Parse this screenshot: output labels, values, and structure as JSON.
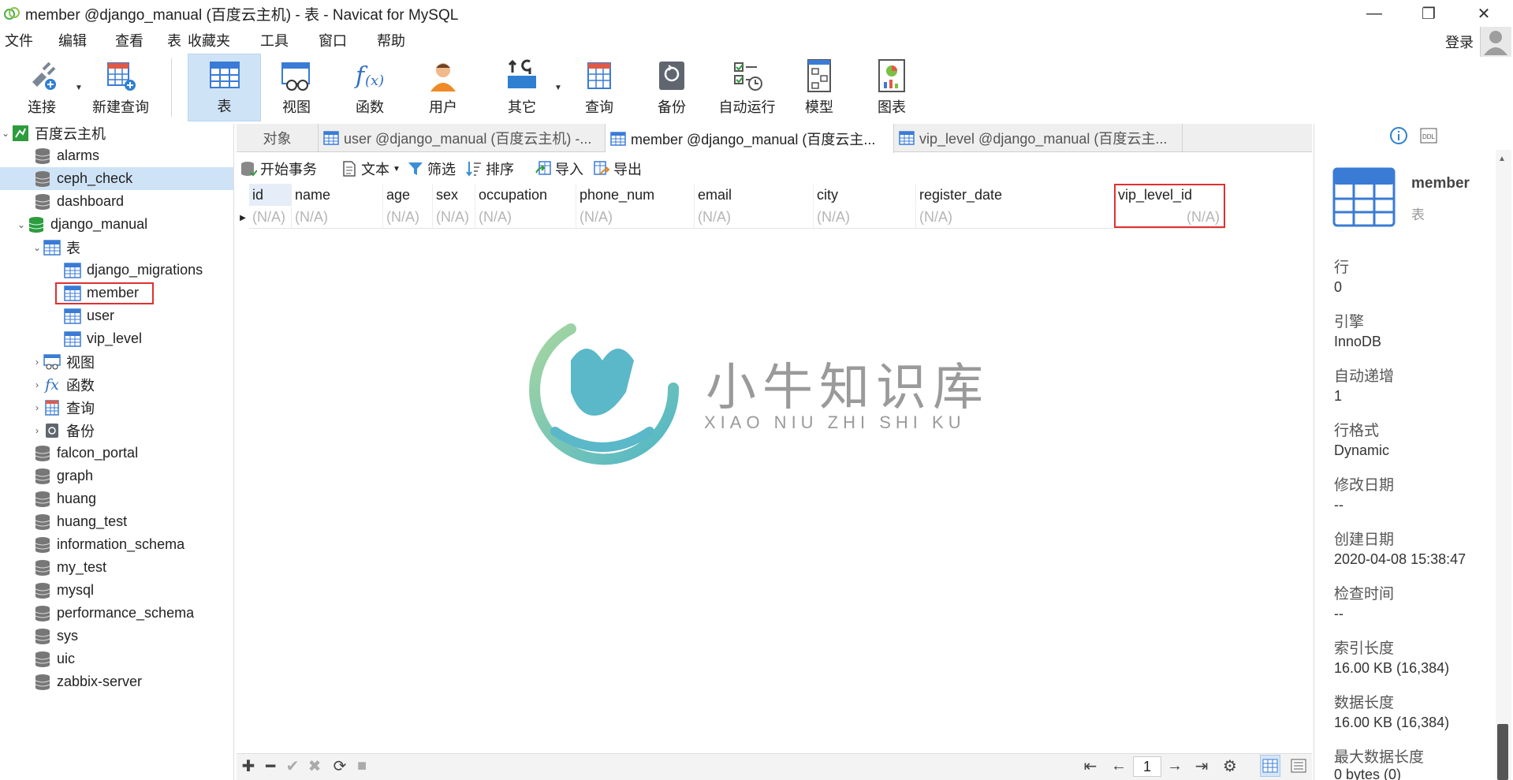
{
  "window": {
    "title": "member @django_manual (百度云主机) - 表 - Navicat for MySQL",
    "minimize": "—",
    "maximize": "❐",
    "close": "✕"
  },
  "menu": [
    "文件",
    "编辑",
    "查看",
    "表",
    "收藏夹",
    "工具",
    "窗口",
    "帮助"
  ],
  "login_label": "登录",
  "toolbar": {
    "connect": "连接",
    "new_query": "新建查询",
    "table": "表",
    "view": "视图",
    "function": "函数",
    "user": "用户",
    "other": "其它",
    "query": "查询",
    "backup": "备份",
    "automation": "自动运行",
    "model": "模型",
    "chart": "图表"
  },
  "sidebar": {
    "connection": "百度云主机",
    "databases_top": [
      "alarms",
      "ceph_check",
      "dashboard",
      "django_manual"
    ],
    "group_tables": "表",
    "tables": [
      "django_migrations",
      "member",
      "user",
      "vip_level"
    ],
    "group_views": "视图",
    "group_functions": "函数",
    "group_queries": "查询",
    "group_backups": "备份",
    "databases_bottom": [
      "falcon_portal",
      "graph",
      "huang",
      "huang_test",
      "information_schema",
      "my_test",
      "mysql",
      "performance_schema",
      "sys",
      "uic",
      "zabbix-server"
    ]
  },
  "tabs": {
    "objects": "对象",
    "tab1": "user @django_manual (百度云主机) -...",
    "tab2": "member @django_manual (百度云主...",
    "tab3": "vip_level @django_manual (百度云主..."
  },
  "subtoolbar": {
    "begin_tx": "开始事务",
    "text": "文本",
    "filter": "筛选",
    "sort": "排序",
    "import": "导入",
    "export": "导出"
  },
  "grid": {
    "columns": [
      "id",
      "name",
      "age",
      "sex",
      "occupation",
      "phone_num",
      "email",
      "city",
      "register_date",
      "vip_level_id"
    ],
    "row": [
      "(N/A)",
      "(N/A)",
      "(N/A)",
      "(N/A)",
      "(N/A)",
      "(N/A)",
      "(N/A)",
      "(N/A)",
      "(N/A)",
      "(N/A)"
    ]
  },
  "watermark": {
    "cn": "小牛知识库",
    "en": "XIAO NIU ZHI SHI KU"
  },
  "pager": {
    "page": "1"
  },
  "info_panel": {
    "name": "member",
    "type": "表",
    "rows_label": "行",
    "rows_value": "0",
    "engine_label": "引擎",
    "engine_value": "InnoDB",
    "auto_inc_label": "自动递增",
    "auto_inc_value": "1",
    "row_format_label": "行格式",
    "row_format_value": "Dynamic",
    "modified_label": "修改日期",
    "modified_value": "--",
    "created_label": "创建日期",
    "created_value": "2020-04-08 15:38:47",
    "checked_label": "检查时间",
    "checked_value": "--",
    "index_len_label": "索引长度",
    "index_len_value": "16.00 KB (16,384)",
    "data_len_label": "数据长度",
    "data_len_value": "16.00 KB (16,384)",
    "max_data_label": "最大数据长度",
    "max_data_value": "0 bytes (0)"
  },
  "colors": {
    "selection": "#cfe3f7",
    "highlight_box": "#e03030",
    "table_icon": "#3a7bd5",
    "db_icon_green": "#2e9b3e"
  }
}
